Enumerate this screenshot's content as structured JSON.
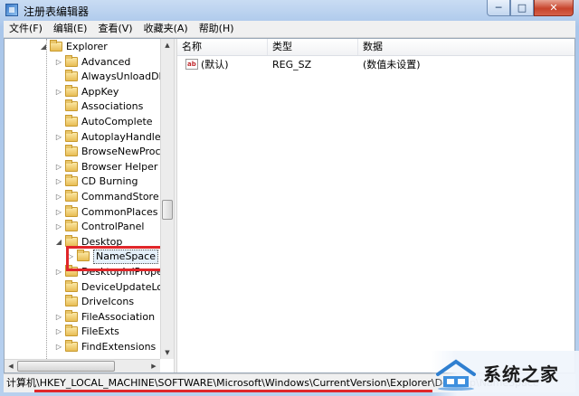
{
  "window": {
    "title": "注册表编辑器",
    "controls": {
      "minimize": "─",
      "maximize": "□",
      "close": "✕"
    }
  },
  "menubar": [
    "文件(F)",
    "编辑(E)",
    "查看(V)",
    "收藏夹(A)",
    "帮助(H)"
  ],
  "tree": {
    "parent": {
      "label": "Explorer",
      "expanded": true
    },
    "items": [
      {
        "label": "Advanced",
        "expandable": true
      },
      {
        "label": "AlwaysUnloadDLL",
        "expandable": false
      },
      {
        "label": "AppKey",
        "expandable": true
      },
      {
        "label": "Associations",
        "expandable": false
      },
      {
        "label": "AutoComplete",
        "expandable": false
      },
      {
        "label": "AutoplayHandlers",
        "expandable": true
      },
      {
        "label": "BrowseNewProce",
        "expandable": false
      },
      {
        "label": "Browser Helper C",
        "expandable": true
      },
      {
        "label": "CD Burning",
        "expandable": true
      },
      {
        "label": "CommandStore",
        "expandable": true
      },
      {
        "label": "CommonPlaces",
        "expandable": true
      },
      {
        "label": "ControlPanel",
        "expandable": true
      },
      {
        "label": "Desktop",
        "expandable": true,
        "expanded": true
      },
      {
        "label": "NameSpace",
        "expandable": true,
        "selected": true,
        "child": true
      },
      {
        "label": "DesktopIniPropel",
        "expandable": true
      },
      {
        "label": "DeviceUpdateLoca",
        "expandable": false
      },
      {
        "label": "DriveIcons",
        "expandable": false
      },
      {
        "label": "FileAssociation",
        "expandable": true
      },
      {
        "label": "FileExts",
        "expandable": true
      },
      {
        "label": "FindExtensions",
        "expandable": true
      }
    ]
  },
  "list": {
    "columns": [
      "名称",
      "类型",
      "数据"
    ],
    "rows": [
      {
        "name": "(默认)",
        "type": "REG_SZ",
        "data": "(数值未设置)"
      }
    ]
  },
  "statusbar": {
    "path": "计算机\\HKEY_LOCAL_MACHINE\\SOFTWARE\\Microsoft\\Windows\\CurrentVersion\\Explorer\\Desktop\\NameSpace"
  },
  "watermark": {
    "text": "系统之家"
  },
  "colors": {
    "highlight": "#e0262a",
    "close_button": "#c7442c"
  }
}
